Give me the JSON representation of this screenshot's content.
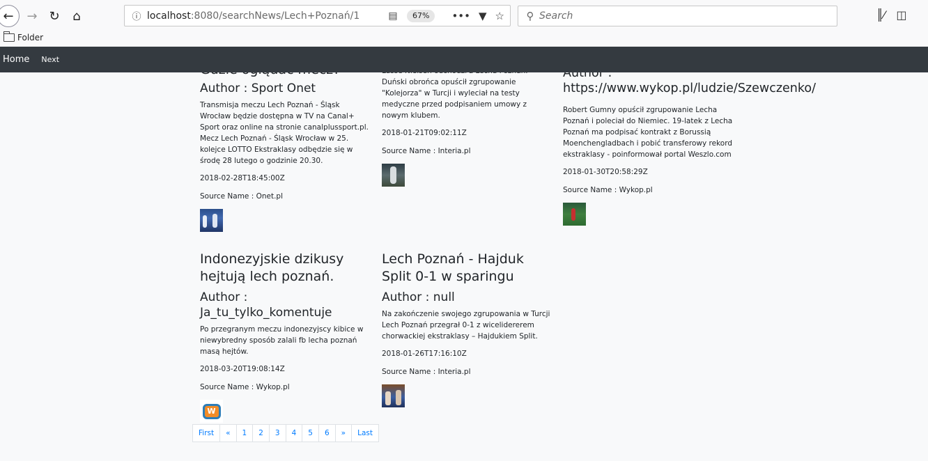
{
  "browser": {
    "url_host": "localhost",
    "url_rest": ":8080/searchNews/Lech+Poznań/1",
    "zoom": "67%",
    "search_placeholder": "Search",
    "bookmark_folder": "Folder"
  },
  "navbar": {
    "brand": "Home",
    "next": "Next"
  },
  "articles": [
    {
      "title": "Gdzie oglądać mecz?",
      "author": "Author : Sport Onet",
      "description": "Transmisja meczu Lech Poznań - Śląsk Wrocław będzie dostępna w TV na Canal+ Sport oraz online na stronie canalplussport.pl. Mecz Lech Poznań - Śląsk Wrocław w 25. kolejce LOTTO Ekstraklasy odbędzie się w środę 28 lutego o godzinie 20.30.",
      "date": "2018-02-28T18:45:00Z",
      "source": "Source Name : Onet.pl"
    },
    {
      "title": "",
      "author": "",
      "description": "Lasse Nielsen odchodzi z Lecha Poznań. Duński obrońca opuścił zgrupowanie \"Kolejorza\" w Turcji i wyleciał na testy medyczne przed podpisaniem umowy z nowym klubem.",
      "date": "2018-01-21T09:02:11Z",
      "source": "Source Name : Interia.pl"
    },
    {
      "title": "",
      "author": "Author : https://www.wykop.pl/ludzie/Szewczenko/",
      "description": "Robert Gumny opuścił zgrupowanie Lecha Poznań i poleciał do Niemiec. 19-latek z Lecha Poznań ma podpisać kontrakt z Borussią Moenchengladbach i pobić transferowy rekord ekstraklasy - poinformował portal Weszlo.com",
      "date": "2018-01-30T20:58:29Z",
      "source": "Source Name : Wykop.pl"
    },
    {
      "title": "Indonezyjskie dzikusy hejtują lech poznań.",
      "author": "Author : Ja_tu_tylko_komentuje",
      "description": "Po przegranym meczu indonezyjscy kibice w niewybredny sposób zalali fb lecha poznań masą hejtów.",
      "date": "2018-03-20T19:08:14Z",
      "source": "Source Name : Wykop.pl"
    },
    {
      "title": "Lech Poznań - Hajduk Split 0-1 w sparingu",
      "author": "Author : null",
      "description": "Na zakończenie swojego zgrupowania w Turcji Lech Poznań przegrał 0-1 z wicelidererem chorwackiej ekstraklasy – Hajdukiem Split.",
      "date": "2018-01-26T17:16:10Z",
      "source": "Source Name : Interia.pl"
    }
  ],
  "pagination": [
    "First",
    "«",
    "1",
    "2",
    "3",
    "4",
    "5",
    "6",
    "»",
    "Last"
  ]
}
